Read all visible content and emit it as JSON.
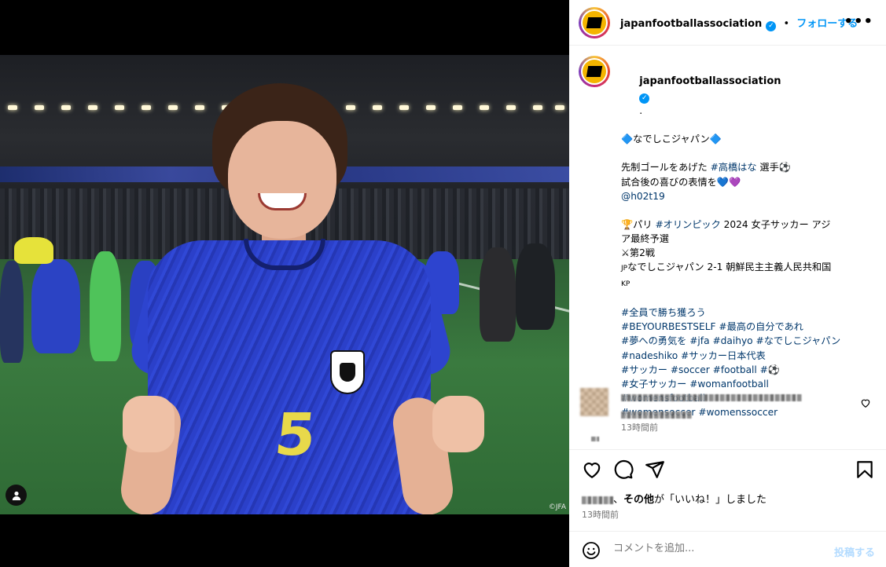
{
  "media": {
    "watermark": "©JFA",
    "jersey_number": "5"
  },
  "header": {
    "username": "japanfootballassociation",
    "verified_mark": "✓",
    "separator": "•",
    "follow_label": "フォローする",
    "more_label": "•••"
  },
  "caption": {
    "username": "japanfootballassociation",
    "suffix": ".",
    "lines": [
      {
        "text": "🔷なでしこジャパン🔷"
      },
      {
        "text": ""
      },
      {
        "prefix": "先制ゴールをあげた ",
        "tag": "#高橋はな",
        "suffix": " 選手⚽"
      },
      {
        "text": "試合後の喜びの表情を💙💜"
      },
      {
        "tag": "@h02t19"
      },
      {
        "text": ""
      },
      {
        "prefix": "🏆パリ ",
        "tag": "#オリンピック",
        "suffix": " 2024 女子サッカー アジ"
      },
      {
        "text": "ア最終予選"
      },
      {
        "text": "⚔第2戦"
      },
      {
        "prefix_small": "JP",
        "text": "なでしこジャパン 2-1 朝鮮民主主義人民共和国"
      },
      {
        "small": "KP"
      },
      {
        "text": ""
      },
      {
        "tag": "#全員で勝ち獲ろう"
      },
      {
        "tag": "#BEYOURBESTSELF #最高の自分であれ"
      },
      {
        "tag": "#夢への勇気を #jfa #daihyo #なでしこジャパン"
      },
      {
        "tag": "#nadeshiko #サッカー日本代表"
      },
      {
        "tag": "#サッカー #soccer #football #⚽"
      },
      {
        "tag": "#女子サッカー #womanfootball"
      },
      {
        "tag": "#womensfootball"
      },
      {
        "tag": "#womensoccer #womenssoccer"
      }
    ],
    "time": "13時間前"
  },
  "likes": {
    "suffix_bold": "その他",
    "suffix_text": "が「いいね！」しました",
    "separator": "、"
  },
  "posted_time": "13時間前",
  "add_comment": {
    "placeholder": "コメントを追加...",
    "post_label": "投稿する"
  },
  "icons": {
    "like": "heart-icon",
    "comment": "comment-icon",
    "share": "share-icon",
    "save": "bookmark-icon",
    "emoji": "emoji-icon",
    "tag": "user-tag-icon"
  },
  "colors": {
    "accent": "#0095f6",
    "hashtag": "#00376b",
    "muted": "#737373",
    "post_disabled": "#b3dbff"
  }
}
